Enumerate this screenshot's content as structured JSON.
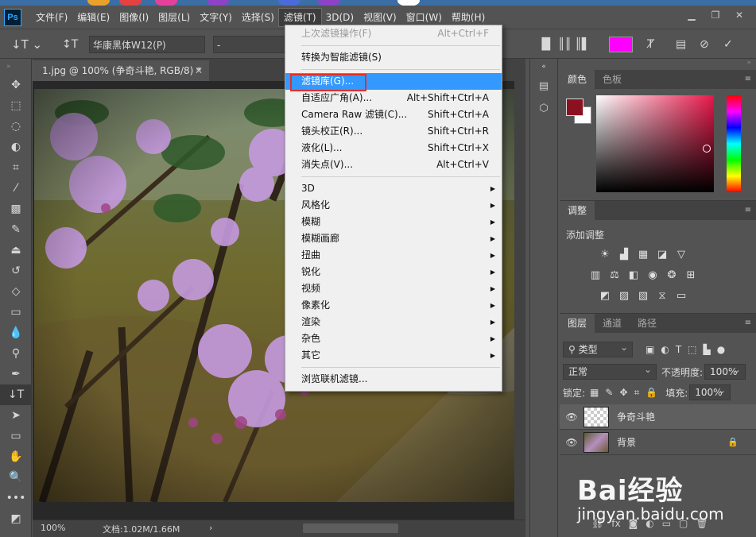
{
  "window": {
    "app_logo": "Ps",
    "controls": {
      "minimize": "▁",
      "restore": "❐",
      "close": "✕"
    }
  },
  "menubar": {
    "items": [
      "文件(F)",
      "编辑(E)",
      "图像(I)",
      "图层(L)",
      "文字(Y)",
      "选择(S)",
      "滤镜(T)",
      "3D(D)",
      "视图(V)",
      "窗口(W)",
      "帮助(H)"
    ],
    "active_index": 6
  },
  "options_bar": {
    "font_family": "华康黑体W12(P)",
    "font_style": "-",
    "text_color": "#ff00ff"
  },
  "document": {
    "tab_title": "1.jpg @ 100% (争奇斗艳, RGB/8) *",
    "zoom": "100%",
    "doc_info": "文档:1.02M/1.66M"
  },
  "filter_menu": {
    "items": [
      {
        "label": "上次滤镜操作(F)",
        "shortcut": "Alt+Ctrl+F",
        "disabled": true
      },
      {
        "separator": true
      },
      {
        "label": "转换为智能滤镜(S)"
      },
      {
        "separator": true
      },
      {
        "label": "滤镜库(G)...",
        "highlighted": true
      },
      {
        "label": "自适应广角(A)...",
        "shortcut": "Alt+Shift+Ctrl+A"
      },
      {
        "label": "Camera Raw 滤镜(C)...",
        "shortcut": "Shift+Ctrl+A"
      },
      {
        "label": "镜头校正(R)...",
        "shortcut": "Shift+Ctrl+R"
      },
      {
        "label": "液化(L)...",
        "shortcut": "Shift+Ctrl+X"
      },
      {
        "label": "消失点(V)...",
        "shortcut": "Alt+Ctrl+V"
      },
      {
        "separator": true
      },
      {
        "label": "3D",
        "submenu": true
      },
      {
        "label": "风格化",
        "submenu": true
      },
      {
        "label": "模糊",
        "submenu": true
      },
      {
        "label": "模糊画廊",
        "submenu": true
      },
      {
        "label": "扭曲",
        "submenu": true
      },
      {
        "label": "锐化",
        "submenu": true
      },
      {
        "label": "视频",
        "submenu": true
      },
      {
        "label": "像素化",
        "submenu": true
      },
      {
        "label": "渲染",
        "submenu": true
      },
      {
        "label": "杂色",
        "submenu": true
      },
      {
        "label": "其它",
        "submenu": true
      },
      {
        "separator": true
      },
      {
        "label": "浏览联机滤镜..."
      }
    ]
  },
  "color_panel": {
    "tabs": [
      "颜色",
      "色板"
    ],
    "foreground": "#8b1020",
    "background": "#ffffff"
  },
  "adjustments_panel": {
    "tab": "调整",
    "title": "添加调整"
  },
  "layers_panel": {
    "tabs": [
      "图层",
      "通道",
      "路径"
    ],
    "filter_kind": "类型",
    "blend_mode": "正常",
    "opacity_label": "不透明度:",
    "opacity_value": "100%",
    "lock_label": "锁定:",
    "fill_label": "填充:",
    "fill_value": "100%",
    "layers": [
      {
        "name": "争奇斗艳",
        "active": true
      },
      {
        "name": "背景",
        "locked": true
      }
    ]
  },
  "watermark": {
    "logo": "Bai经验",
    "url": "jingyan.baidu.com"
  }
}
